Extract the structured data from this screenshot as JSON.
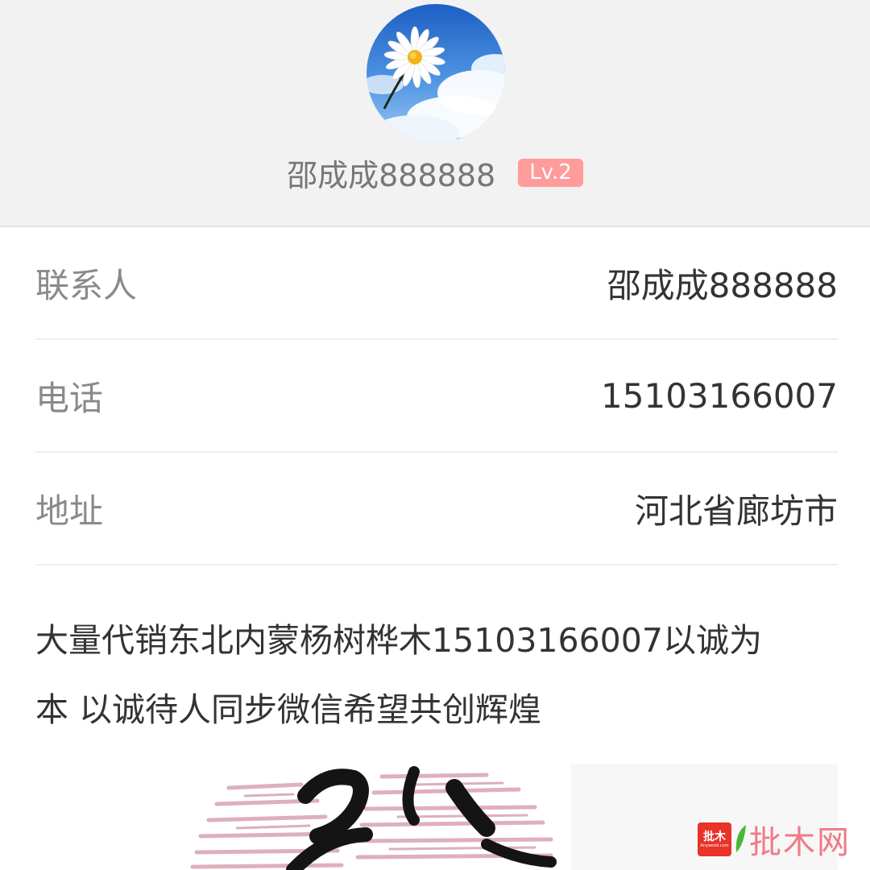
{
  "profile": {
    "name": "邵成成888888",
    "level": "Lv.2"
  },
  "info": {
    "rows": [
      {
        "label": "联系人",
        "value": "邵成成888888"
      },
      {
        "label": "电话",
        "value": "15103166007"
      },
      {
        "label": "地址",
        "value": "河北省廊坊市"
      }
    ]
  },
  "description": {
    "line1": "大量代销东北内蒙杨树桦木15103166007以诚为",
    "line2": "本 以诚待人同步微信希望共创辉煌"
  },
  "watermark": {
    "logo_text": "批木",
    "logo_url": "Anywood.com",
    "text": "批木网"
  },
  "colors": {
    "header_bg": "#f2f2f2",
    "badge_bg": "#ff9b9b",
    "watermark_red": "#e8322a",
    "watermark_pink": "#f07a86"
  }
}
